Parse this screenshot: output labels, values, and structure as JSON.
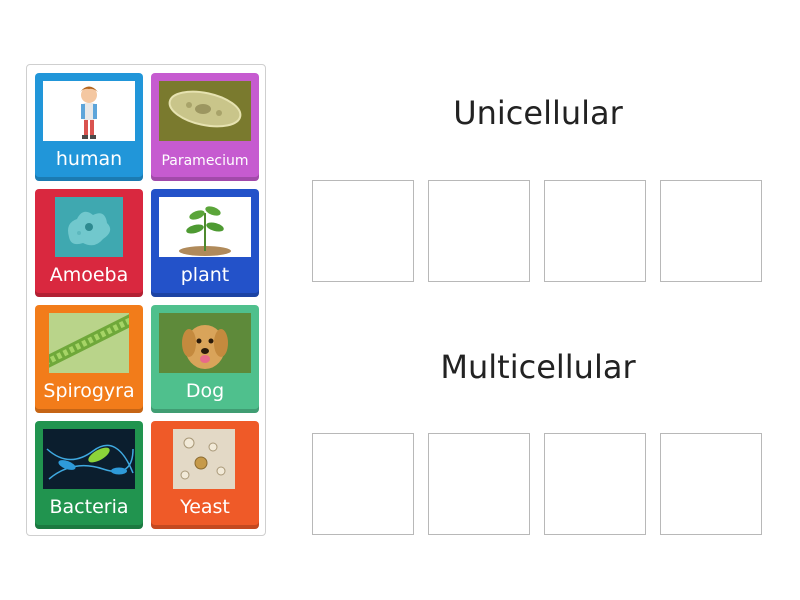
{
  "cards": [
    {
      "id": "human",
      "label": "human",
      "color": "#2196D9",
      "icon": "cartoon-boy-icon"
    },
    {
      "id": "paramecium",
      "label": "Paramecium",
      "color": "#C65BD0",
      "icon": "paramecium-photo-icon"
    },
    {
      "id": "amoeba",
      "label": "Amoeba",
      "color": "#D9283F",
      "icon": "amoeba-photo-icon"
    },
    {
      "id": "plant",
      "label": "plant",
      "color": "#2352C9",
      "icon": "seedling-plant-icon"
    },
    {
      "id": "spirogyra",
      "label": "Spirogyra",
      "color": "#F27C1A",
      "icon": "spirogyra-photo-icon"
    },
    {
      "id": "dog",
      "label": "Dog",
      "color": "#4FC08D",
      "icon": "dog-photo-icon"
    },
    {
      "id": "bacteria",
      "label": "Bacteria",
      "color": "#21944F",
      "icon": "bacteria-photo-icon"
    },
    {
      "id": "yeast",
      "label": "Yeast",
      "color": "#EF5A28",
      "icon": "yeast-photo-icon"
    }
  ],
  "groups": [
    {
      "title": "Unicellular",
      "slots": 4
    },
    {
      "title": "Multicellular",
      "slots": 4
    }
  ]
}
